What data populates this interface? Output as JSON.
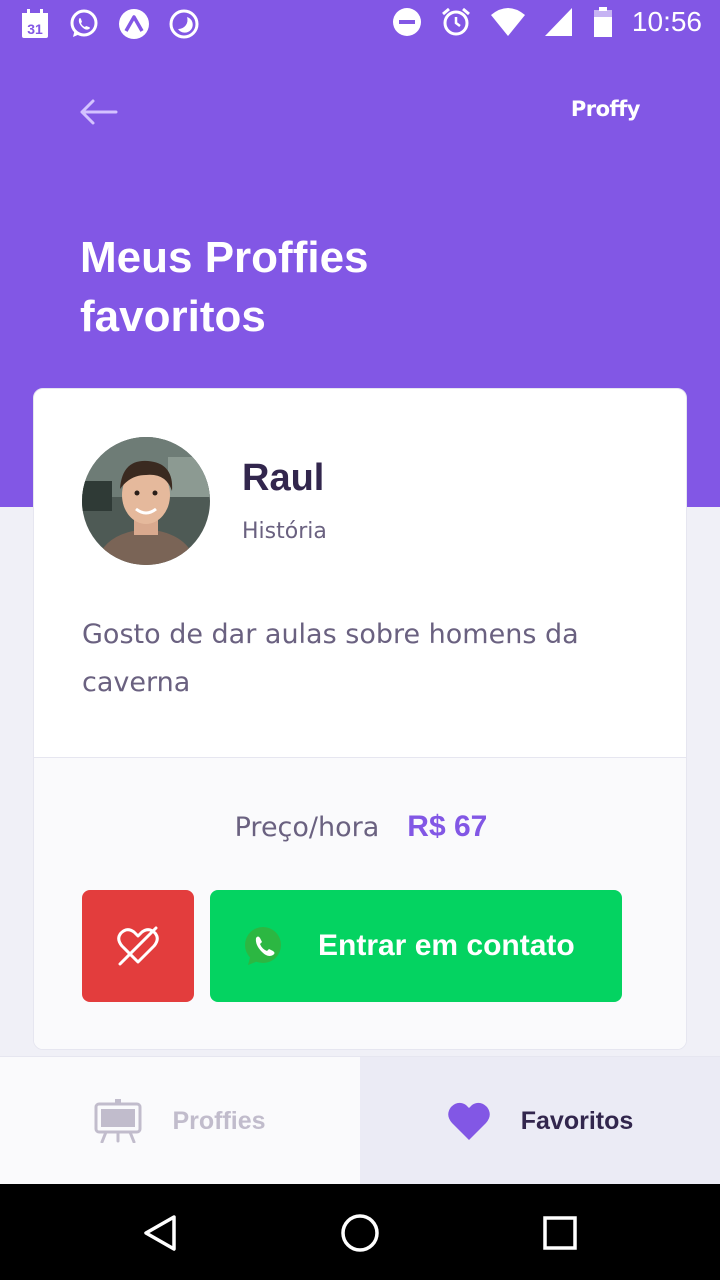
{
  "status_bar": {
    "time": "10:56",
    "calendar_day": "31",
    "left_icons": [
      "calendar-icon",
      "whatsapp-icon",
      "expo-icon",
      "moon-icon"
    ],
    "right_icons": [
      "do-not-disturb-icon",
      "alarm-icon",
      "wifi-icon",
      "signal-icon",
      "battery-icon"
    ]
  },
  "header": {
    "brand": "Proffy",
    "title": "Meus Proffies favoritos"
  },
  "teacher_card": {
    "name": "Raul",
    "subject": "História",
    "bio": "Gosto de dar aulas sobre homens da caverna",
    "price_label": "Preço/hora",
    "price_value": "R$ 67",
    "contact_label": "Entrar em contato",
    "unfavorite_icon": "heart-outline-off-icon",
    "contact_icon": "whatsapp-icon"
  },
  "tabs": [
    {
      "label": "Proffies",
      "icon": "easel-icon",
      "active": false
    },
    {
      "label": "Favoritos",
      "icon": "heart-icon",
      "active": true
    }
  ],
  "nav_bar": [
    "back-triangle-icon",
    "home-circle-icon",
    "recents-square-icon"
  ],
  "colors": {
    "primary": "#8257E5",
    "danger": "#E33D3D",
    "success": "#04D361",
    "title_dark": "#32264D",
    "text": "#6A6180",
    "muted": "#C1BCCC"
  }
}
